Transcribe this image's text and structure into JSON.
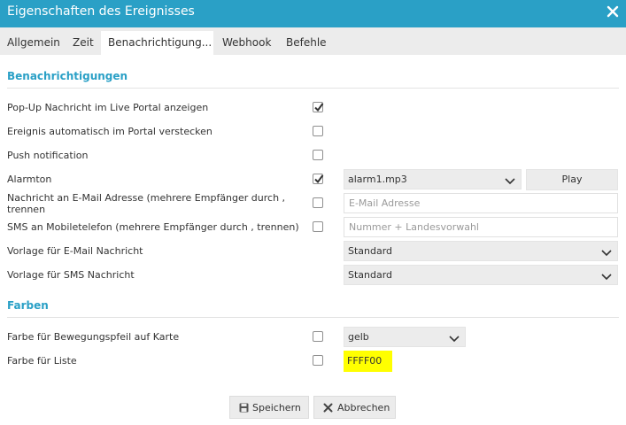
{
  "dialog": {
    "title": "Eigenschaften des Ereignisses",
    "accent_color": "#2aa0c6",
    "close_icon": "close-icon"
  },
  "tabs": [
    {
      "label": "Allgemein",
      "active": false
    },
    {
      "label": "Zeit",
      "active": false
    },
    {
      "label": "Benachrichtigung...",
      "active": true
    },
    {
      "label": "Webhook",
      "active": false
    },
    {
      "label": "Befehle",
      "active": false
    }
  ],
  "notifications": {
    "section_title": "Benachrichtigungen",
    "popup": {
      "label": "Pop-Up Nachricht im Live Portal anzeigen",
      "checked": true
    },
    "auto_hide": {
      "label": "Ereignis automatisch im Portal verstecken",
      "checked": false
    },
    "push": {
      "label": "Push notification",
      "checked": false
    },
    "alarm": {
      "label": "Alarmton",
      "checked": true,
      "sound": "alarm1.mp3",
      "play_label": "Play"
    },
    "email": {
      "label": "Nachricht an E-Mail Adresse (mehrere Empfänger durch , trennen",
      "checked": false,
      "placeholder": "E-Mail Adresse"
    },
    "sms": {
      "label": "SMS an Mobiletelefon (mehrere Empfänger durch , trennen)",
      "checked": false,
      "placeholder": "Nummer + Landesvorwahl"
    },
    "email_template": {
      "label": "Vorlage für E-Mail Nachricht",
      "value": "Standard"
    },
    "sms_template": {
      "label": "Vorlage für SMS Nachricht",
      "value": "Standard"
    }
  },
  "colors": {
    "section_title": "Farben",
    "arrow": {
      "label": "Farbe für Bewegungspfeil auf Karte",
      "checked": false,
      "value": "gelb"
    },
    "list": {
      "label": "Farbe für Liste",
      "checked": false,
      "value": "FFFF00",
      "swatch": "#ffff00"
    }
  },
  "footer": {
    "save": {
      "label": "Speichern",
      "icon": "floppy-disk-icon"
    },
    "cancel": {
      "label": "Abbrechen",
      "icon": "x-icon"
    }
  }
}
